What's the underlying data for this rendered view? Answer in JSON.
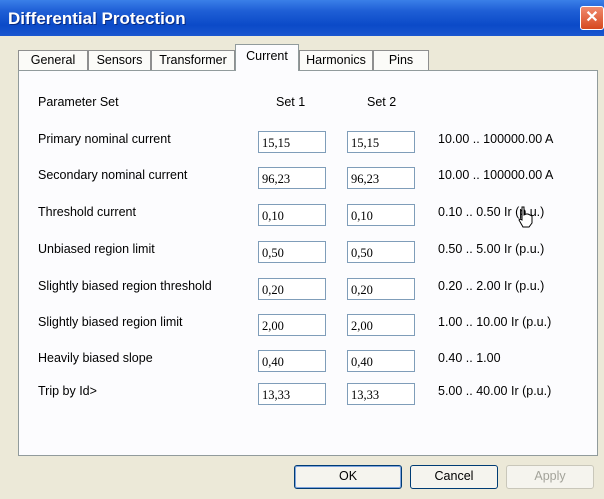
{
  "window": {
    "title": "Differential Protection",
    "close_glyph": "✕"
  },
  "tabs": [
    {
      "label": "General",
      "active": false
    },
    {
      "label": "Sensors",
      "active": false
    },
    {
      "label": "Transformer",
      "active": false
    },
    {
      "label": "Current",
      "active": true
    },
    {
      "label": "Harmonics",
      "active": false
    },
    {
      "label": "Pins",
      "active": false
    }
  ],
  "grid": {
    "param_header": "Parameter Set",
    "set1_header": "Set 1",
    "set2_header": "Set 2",
    "rows": [
      {
        "label": "Primary nominal current",
        "set1": "15,15",
        "set2": "15,15",
        "range": "10.00 .. 100000.00 A"
      },
      {
        "label": "Secondary nominal current",
        "set1": "96,23",
        "set2": "96,23",
        "range": "10.00 .. 100000.00 A"
      },
      {
        "label": "Threshold current",
        "set1": "0,10",
        "set2": "0,10",
        "range": "0.10 .. 0.50 Ir (p.u.)"
      },
      {
        "label": "Unbiased region limit",
        "set1": "0,50",
        "set2": "0,50",
        "range": "0.50 .. 5.00 Ir (p.u.)"
      },
      {
        "label": "Slightly biased region threshold",
        "set1": "0,20",
        "set2": "0,20",
        "range": "0.20 .. 2.00 Ir (p.u.)"
      },
      {
        "label": "Slightly biased region limit",
        "set1": "2,00",
        "set2": "2,00",
        "range": "1.00 .. 10.00 Ir (p.u.)"
      },
      {
        "label": "Heavily biased slope",
        "set1": "0,40",
        "set2": "0,40",
        "range": "0.40 .. 1.00"
      },
      {
        "label": "Trip by Id>",
        "set1": "13,33",
        "set2": "13,33",
        "range": "5.00 .. 40.00 Ir (p.u.)"
      }
    ]
  },
  "buttons": {
    "ok": "OK",
    "cancel": "Cancel",
    "apply": "Apply"
  }
}
